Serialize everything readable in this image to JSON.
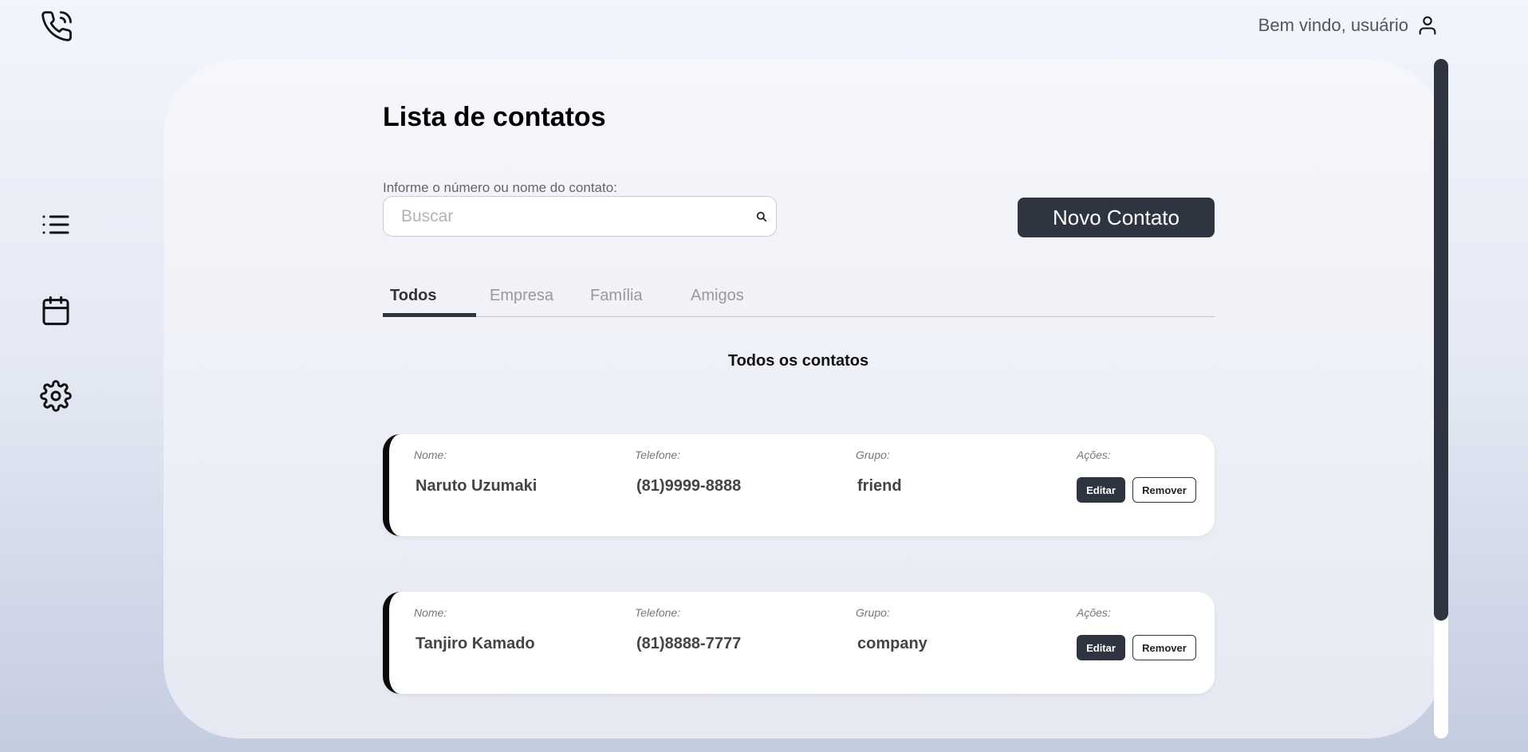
{
  "header": {
    "welcome_text": "Bem vindo, usuário",
    "logo_icon": "phone-call-icon",
    "user_icon": "user-icon"
  },
  "sidebar": {
    "items": [
      {
        "icon": "list-icon"
      },
      {
        "icon": "calendar-icon"
      },
      {
        "icon": "gear-icon"
      }
    ]
  },
  "main": {
    "title": "Lista de contatos",
    "search": {
      "label": "Informe o número ou nome do contato:",
      "placeholder": "Buscar",
      "value": ""
    },
    "new_contact_label": "Novo Contato",
    "tabs": [
      {
        "label": "Todos",
        "active": true
      },
      {
        "label": "Empresa",
        "active": false
      },
      {
        "label": "Família",
        "active": false
      },
      {
        "label": "Amigos",
        "active": false
      }
    ],
    "section_title": "Todos os contatos",
    "columns": {
      "name": "Nome:",
      "phone": "Telefone:",
      "group": "Grupo:",
      "actions": "Ações:"
    },
    "contacts": [
      {
        "name": "Naruto Uzumaki",
        "phone": "(81)9999-8888",
        "group": "friend",
        "edit_label": "Editar",
        "remove_label": "Remover"
      },
      {
        "name": "Tanjiro Kamado",
        "phone": "(81)8888-7777",
        "group": "company",
        "edit_label": "Editar",
        "remove_label": "Remover"
      }
    ]
  },
  "colors": {
    "accent_dark": "#2f3540",
    "card_border": "#0a0a0a"
  }
}
